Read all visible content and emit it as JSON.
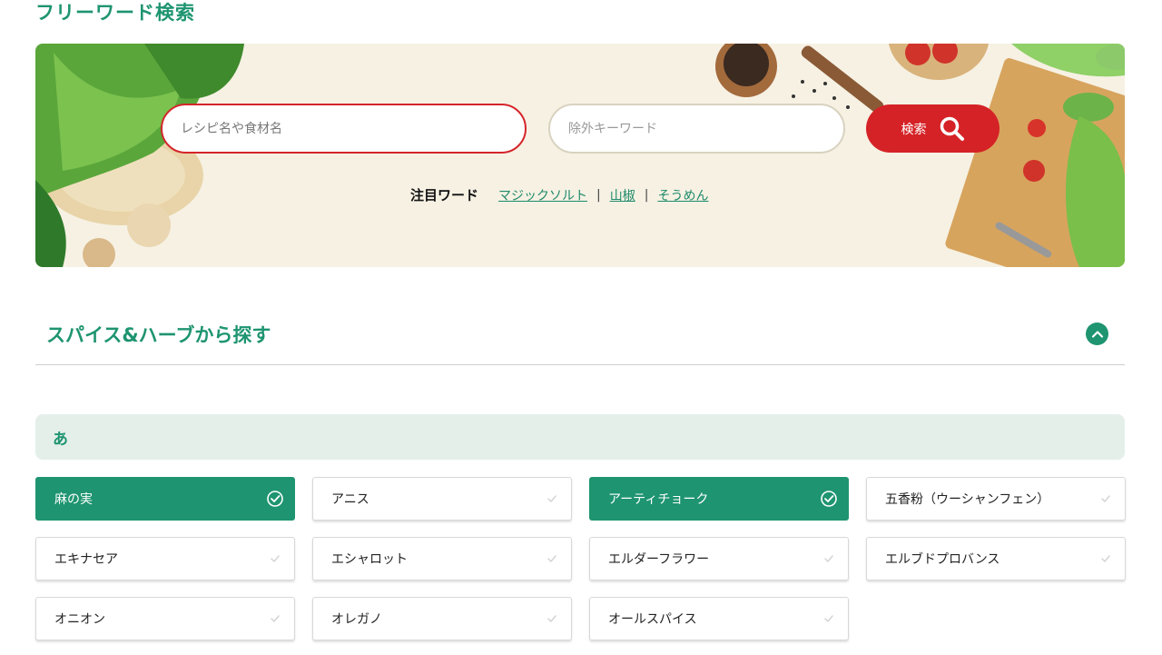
{
  "page": {
    "title": "フリーワード検索"
  },
  "search": {
    "placeholder": "レシピ名や食材名",
    "exclude_placeholder": "除外キーワード",
    "button_label": "検索"
  },
  "trending": {
    "label": "注目ワード",
    "words": [
      "マジックソルト",
      "山椒",
      "そうめん"
    ]
  },
  "section": {
    "title": "スパイス&ハーブから探す"
  },
  "kana_group": {
    "label": "あ"
  },
  "spices": [
    {
      "name": "麻の実",
      "selected": true
    },
    {
      "name": "アニス",
      "selected": false
    },
    {
      "name": "アーティチョーク",
      "selected": true
    },
    {
      "name": "五香粉（ウーシャンフェン）",
      "selected": false
    },
    {
      "name": "エキナセア",
      "selected": false
    },
    {
      "name": "エシャロット",
      "selected": false
    },
    {
      "name": "エルダーフラワー",
      "selected": false
    },
    {
      "name": "エルブドプロバンス",
      "selected": false
    },
    {
      "name": "オニオン",
      "selected": false
    },
    {
      "name": "オレガノ",
      "selected": false
    },
    {
      "name": "オールスパイス",
      "selected": false
    }
  ],
  "colors": {
    "accent": "#1e9470",
    "search_red": "#d52226",
    "group_bg": "#e4efea",
    "hero_bg": "#f6f1e3"
  }
}
